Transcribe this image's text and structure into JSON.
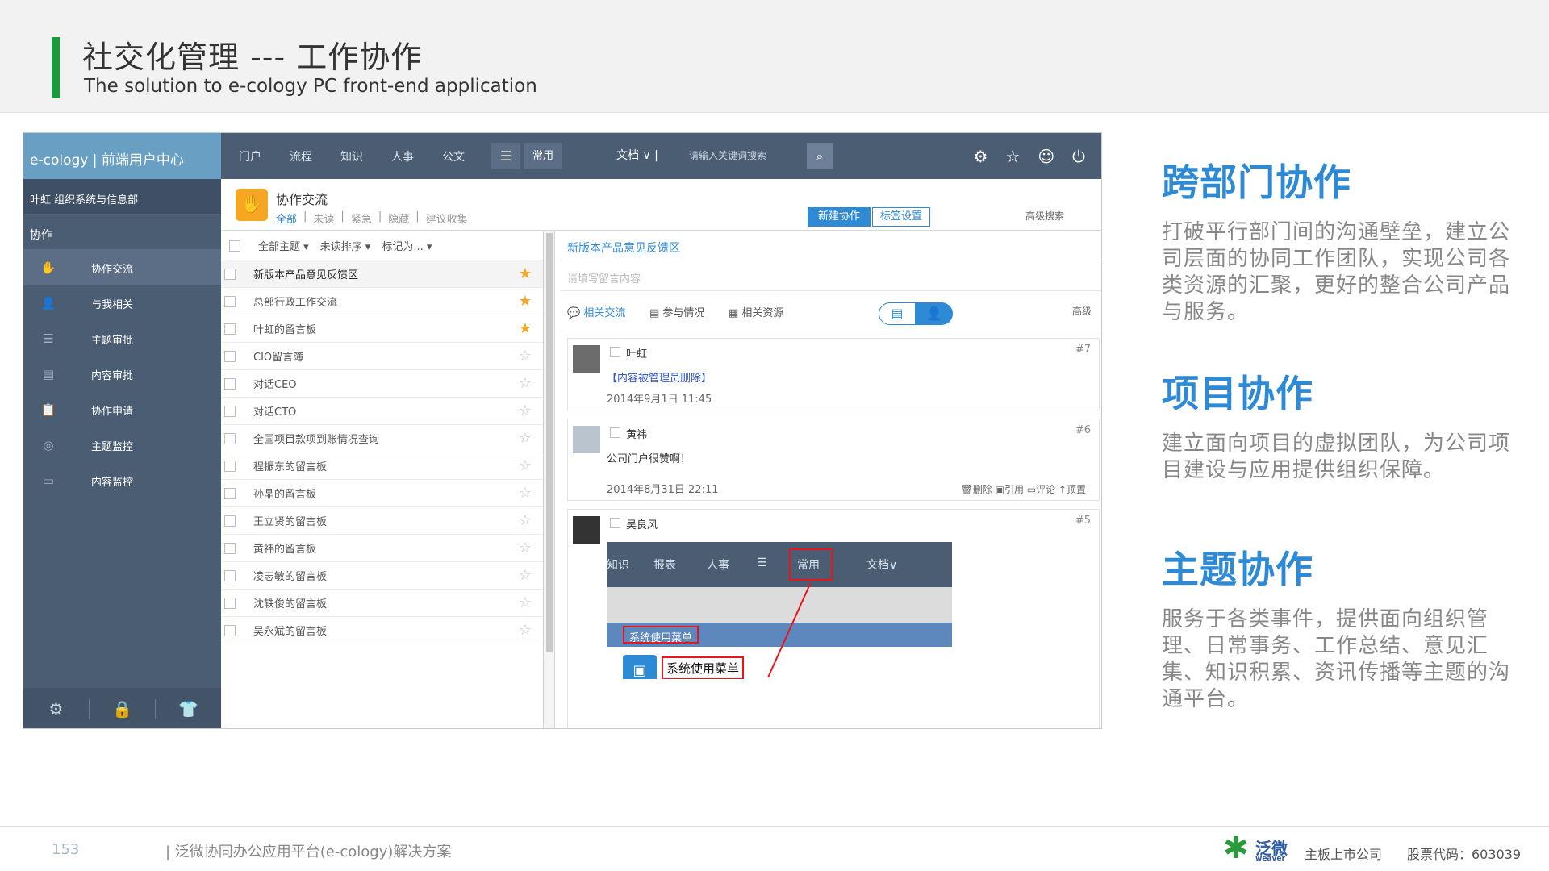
{
  "slide": {
    "title": "社交化管理 --- 工作协作",
    "subtitle": "The solution to e-cology PC front-end application",
    "accent_color": "#1a9a3a"
  },
  "app": {
    "brand": "e-cology | 前端用户中心",
    "user_row": "叶虹  组织系统与信息部",
    "section": "协作",
    "sidebar_items": [
      {
        "label": "协作交流",
        "icon": "hand-icon"
      },
      {
        "label": "与我相关",
        "icon": "person-icon"
      },
      {
        "label": "主题审批",
        "icon": "list-icon"
      },
      {
        "label": "内容审批",
        "icon": "doc-icon"
      },
      {
        "label": "协作申请",
        "icon": "clipboard-icon"
      },
      {
        "label": "主题监控",
        "icon": "monitor-icon"
      },
      {
        "label": "内容监控",
        "icon": "screen-icon"
      }
    ],
    "top_nav": [
      "门户",
      "流程",
      "知识",
      "人事",
      "公文"
    ],
    "common_label": "常用",
    "search_scope": "文档 ∨ |",
    "search_placeholder": "请输入关键词搜索",
    "content_title": "协作交流",
    "content_tabs": [
      "全部",
      "|",
      "未读",
      "|",
      "紧急",
      "|",
      "隐藏",
      "|",
      "建议收集"
    ],
    "new_button": "新建协作",
    "tag_button": "标签设置",
    "advanced_search": "高级搜索",
    "list_toolbar": [
      "全部主题 ▾",
      "未读排序 ▾",
      "标记为... ▾"
    ],
    "list_items": [
      {
        "label": "新版本产品意见反馈区",
        "starred": true
      },
      {
        "label": "总部行政工作交流",
        "starred": true
      },
      {
        "label": "叶虹的留言板",
        "starred": true
      },
      {
        "label": "CIO留言簿",
        "starred": false
      },
      {
        "label": "对话CEO",
        "starred": false
      },
      {
        "label": "对话CTO",
        "starred": false
      },
      {
        "label": "全国项目款项到账情况查询",
        "starred": false
      },
      {
        "label": "程振东的留言板",
        "starred": false
      },
      {
        "label": "孙晶的留言板",
        "starred": false
      },
      {
        "label": "王立贤的留言板",
        "starred": false
      },
      {
        "label": "黄祎的留言板",
        "starred": false
      },
      {
        "label": "凌志敏的留言板",
        "starred": false
      },
      {
        "label": "沈轶俊的留言板",
        "starred": false
      },
      {
        "label": "吴永斌的留言板",
        "starred": false
      }
    ],
    "detail_title": "新版本产品意见反馈区",
    "reply_placeholder": "请填写留言内容",
    "detail_tabs": [
      "相关交流",
      "参与情况",
      "相关资源"
    ],
    "detail_adv": "高级",
    "posts": [
      {
        "name": "叶虹",
        "num": "#7",
        "body": "【内容被管理员删除】",
        "time": "2014年9月1日 11:45"
      },
      {
        "name": "黄祎",
        "num": "#6",
        "body": "公司门户很赞啊！",
        "time": "2014年8月31日 22:11",
        "actions": "🗑删除  ▣引用  ▭评论  ↑顶置"
      },
      {
        "name": "吴良风",
        "num": "#5"
      }
    ],
    "embed": {
      "nav": [
        "知识",
        "报表",
        "人事"
      ],
      "common": "常用",
      "scope": "文档∨",
      "menu_label": "系统使用菜单"
    }
  },
  "features": [
    {
      "title": "跨部门协作",
      "text": "打破平行部门间的沟通壁垒，建立公司层面的协同工作团队，实现公司各类资源的汇聚，更好的整合公司产品与服务。"
    },
    {
      "title": "项目协作",
      "text": "建立面向项目的虚拟团队，为公司项目建设与应用提供组织保障。"
    },
    {
      "title": "主题协作",
      "text": "服务于各类事件，提供面向组织管理、日常事务、工作总结、意见汇集、知识积累、资讯传播等主题的沟通平台。"
    }
  ],
  "footer": {
    "page": "153",
    "text": "| 泛微协同办公应用平台(e-cology)解决方案",
    "logo_cn": "泛微",
    "logo_en": "weaver",
    "company": "主板上市公司",
    "stock": "股票代码：603039"
  },
  "colors": {
    "blue": "#2f8ad6",
    "sidebar": "#4b5d73",
    "star": "#f5a623"
  }
}
